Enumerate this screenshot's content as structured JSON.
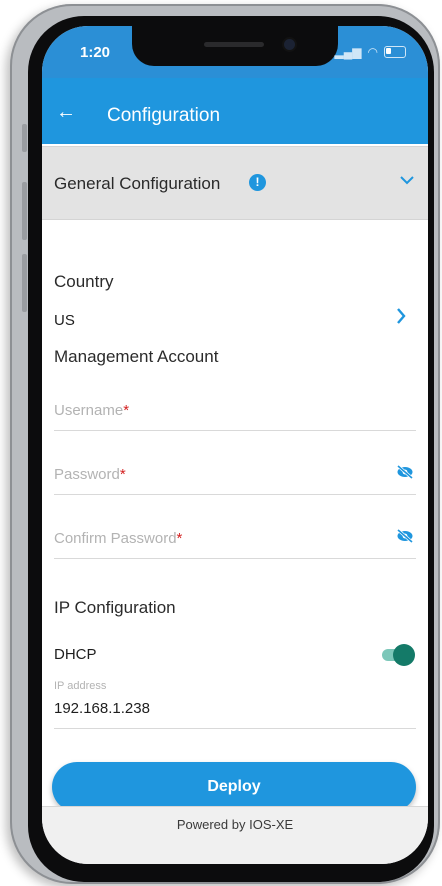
{
  "status_bar": {
    "time": "1:20"
  },
  "app_bar": {
    "back_icon": "arrow-left-icon",
    "title": "Configuration"
  },
  "section": {
    "title": "General Configuration",
    "info_icon": "info-icon",
    "chevron": "chevron-down-icon"
  },
  "country": {
    "label": "Country",
    "value": "US"
  },
  "management": {
    "label": "Management Account",
    "username": {
      "placeholder": "Username",
      "required_mark": "*"
    },
    "password": {
      "placeholder": "Password",
      "required_mark": "*"
    },
    "confirm_password": {
      "placeholder": "Confirm Password",
      "required_mark": "*"
    }
  },
  "ip_config": {
    "label": "IP Configuration",
    "dhcp_label": "DHCP",
    "dhcp_enabled": true,
    "ip_label": "IP address",
    "ip_value": "192.168.1.238"
  },
  "deploy_label": "Deploy",
  "footer": "Powered by IOS-XE",
  "colors": {
    "primary": "#1f96de",
    "toggle_on": "#147a68",
    "required": "#d32020"
  }
}
